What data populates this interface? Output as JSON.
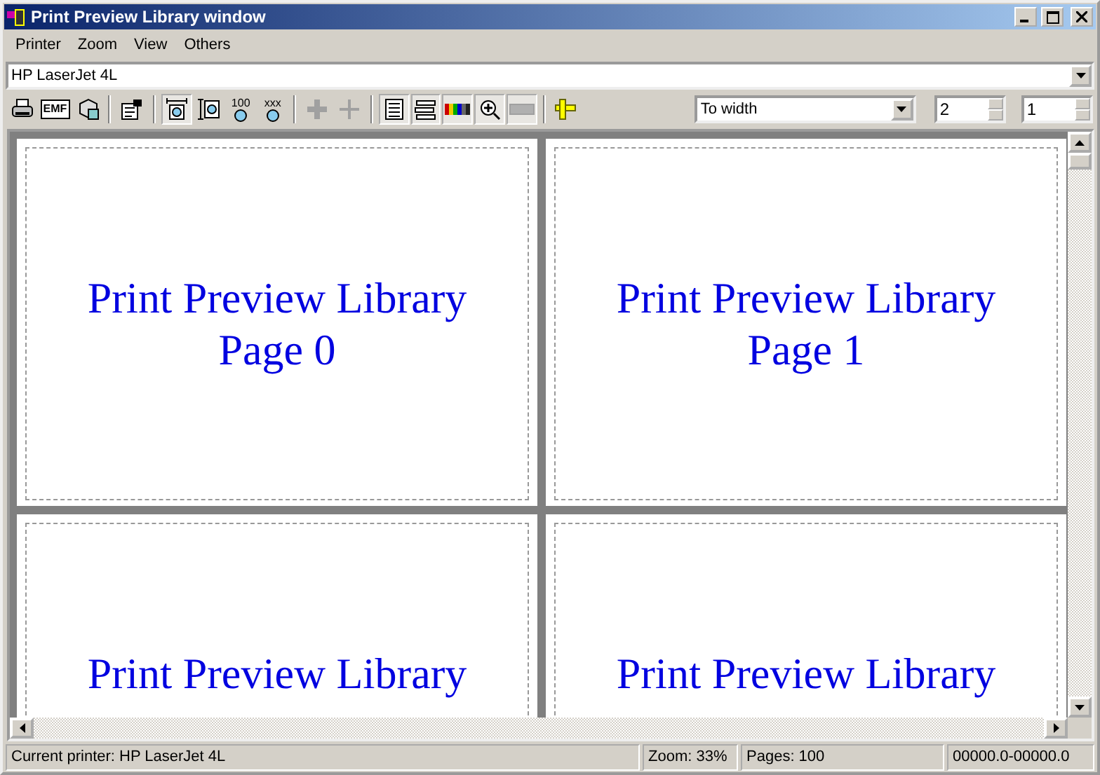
{
  "window": {
    "title": "Print Preview Library window"
  },
  "menu": [
    "Printer",
    "Zoom",
    "View",
    "Others"
  ],
  "printer_combo": {
    "value": "HP LaserJet 4L"
  },
  "toolbar": [
    {
      "kind": "print",
      "pressed": false,
      "disabled": false
    },
    {
      "kind": "emf",
      "pressed": false,
      "disabled": false,
      "label": "EMF"
    },
    {
      "kind": "disk",
      "pressed": false,
      "disabled": false
    },
    {
      "kind": "sep"
    },
    {
      "kind": "properties",
      "pressed": false,
      "disabled": false
    },
    {
      "kind": "sep"
    },
    {
      "kind": "fit-width",
      "pressed": true,
      "disabled": false
    },
    {
      "kind": "fit-height",
      "pressed": false,
      "disabled": false
    },
    {
      "kind": "zoom-label",
      "pressed": false,
      "disabled": false,
      "label": "100"
    },
    {
      "kind": "zoom-label",
      "pressed": false,
      "disabled": false,
      "label": "xxx"
    },
    {
      "kind": "sep"
    },
    {
      "kind": "move",
      "pressed": false,
      "disabled": true
    },
    {
      "kind": "cross",
      "pressed": false,
      "disabled": true
    },
    {
      "kind": "sep"
    },
    {
      "kind": "page",
      "pressed": true,
      "disabled": false
    },
    {
      "kind": "stack",
      "pressed": true,
      "disabled": false
    },
    {
      "kind": "colors",
      "pressed": true,
      "disabled": false
    },
    {
      "kind": "zoom-in",
      "pressed": true,
      "disabled": false
    },
    {
      "kind": "bar",
      "pressed": true,
      "disabled": true
    },
    {
      "kind": "sep"
    },
    {
      "kind": "ruler",
      "pressed": false,
      "disabled": false
    }
  ],
  "zoom_combo": {
    "value": "To width"
  },
  "columns_spin": {
    "value": "2"
  },
  "rows_spin": {
    "value": "1"
  },
  "pages": [
    {
      "title": "Print Preview Library",
      "subtitle": "Page 0"
    },
    {
      "title": "Print Preview Library",
      "subtitle": "Page 1"
    },
    {
      "title": "Print Preview Library"
    },
    {
      "title": "Print Preview Library"
    }
  ],
  "status_bar": [
    "Current printer: HP LaserJet 4L",
    "Zoom: 33%",
    "Pages: 100",
    "00000.0-00000.0"
  ]
}
